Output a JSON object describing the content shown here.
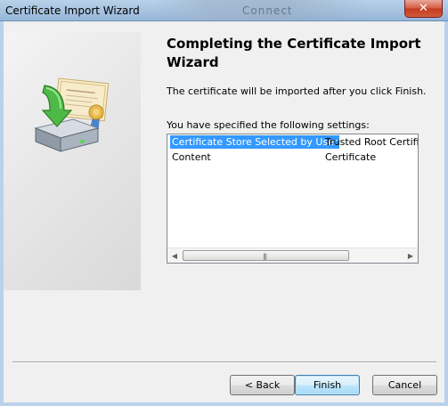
{
  "window": {
    "title": "Certificate Import Wizard",
    "background_title": "Connect",
    "close_glyph": "✕"
  },
  "wizard": {
    "heading": "Completing the Certificate Import Wizard",
    "description": "The certificate will be imported after you click Finish.",
    "settings_label": "You have specified the following settings:"
  },
  "settings": {
    "rows": [
      {
        "name": "Certificate Store Selected by User",
        "value": "Trusted Root Certification Authorities"
      },
      {
        "name": "Content",
        "value": "Certificate"
      }
    ]
  },
  "scrollbar": {
    "left_glyph": "◀",
    "right_glyph": "▶",
    "grip_glyph": "|||"
  },
  "buttons": {
    "back": "< Back",
    "finish": "Finish",
    "cancel": "Cancel"
  },
  "colors": {
    "selection": "#3399ff",
    "default_button_border": "#3c7fb1"
  },
  "icons": [
    "certificate-import-icon",
    "close-icon"
  ]
}
